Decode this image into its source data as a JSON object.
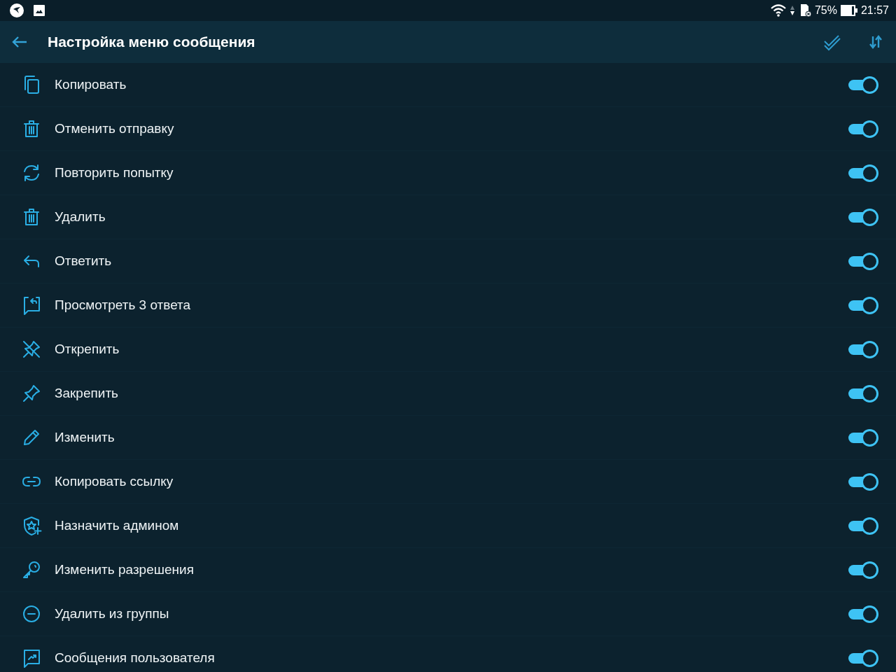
{
  "status_bar": {
    "battery": "75%",
    "time": "21:57"
  },
  "toolbar": {
    "title": "Настройка меню сообщения"
  },
  "items": [
    {
      "kind": "copy",
      "label": "Копировать",
      "on": true
    },
    {
      "kind": "trash",
      "label": "Отменить отправку",
      "on": true
    },
    {
      "kind": "retry",
      "label": "Повторить попытку",
      "on": true
    },
    {
      "kind": "trash",
      "label": "Удалить",
      "on": true
    },
    {
      "kind": "reply",
      "label": "Ответить",
      "on": true
    },
    {
      "kind": "replies",
      "label": "Просмотреть 3 ответа",
      "on": true
    },
    {
      "kind": "unpin",
      "label": "Открепить",
      "on": true
    },
    {
      "kind": "pin",
      "label": "Закрепить",
      "on": true
    },
    {
      "kind": "edit",
      "label": "Изменить",
      "on": true
    },
    {
      "kind": "link",
      "label": "Копировать ссылку",
      "on": true
    },
    {
      "kind": "admin",
      "label": "Назначить админом",
      "on": true
    },
    {
      "kind": "key",
      "label": "Изменить разрешения",
      "on": true
    },
    {
      "kind": "remove",
      "label": "Удалить из группы",
      "on": true
    },
    {
      "kind": "messages",
      "label": "Сообщения пользователя",
      "on": true
    }
  ]
}
